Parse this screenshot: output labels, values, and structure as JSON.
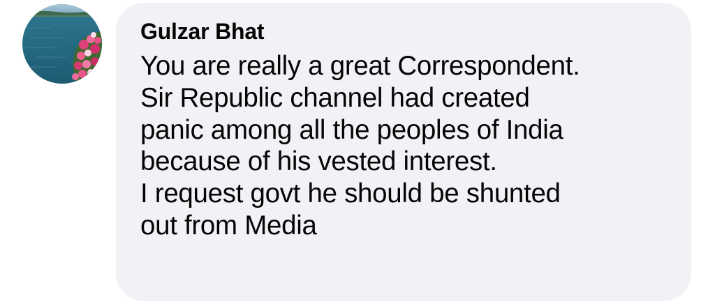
{
  "comment": {
    "author": "Gulzar Bhat",
    "lines": [
      "You are really a great Correspondent.",
      "Sir Republic channel had created",
      "panic among all the peoples of India",
      "because of his vested interest.",
      "I request govt he should be shunted",
      "out from Media"
    ],
    "avatar_icon": "profile-photo-lake-flowers"
  },
  "colors": {
    "bubble_background": "#f0f2f5",
    "text": "#050505"
  }
}
